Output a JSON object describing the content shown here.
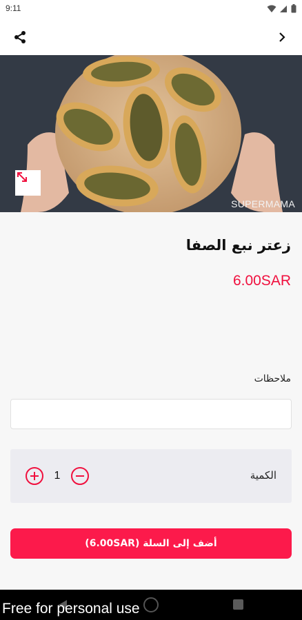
{
  "status_bar": {
    "time": "9:11"
  },
  "app_bar": {
    "share_icon": "share-icon",
    "next_icon": "chevron-right-icon"
  },
  "hero": {
    "watermark": "SUPERMAMA",
    "expand_icon": "expand-diagonal-icon"
  },
  "product": {
    "name": "زعتر نبع الصفا",
    "price": "6.00SAR"
  },
  "notes": {
    "label": "ملاحظات",
    "value": "",
    "placeholder": ""
  },
  "quantity": {
    "label": "الكمية",
    "value": "1"
  },
  "cart_button": {
    "label": "أضف إلى السلة (6.00SAR)"
  },
  "overlay": {
    "text": "Free for personal use"
  },
  "colors": {
    "accent": "#f0103e",
    "button": "#fc1a4b",
    "panel": "#ececf1"
  }
}
